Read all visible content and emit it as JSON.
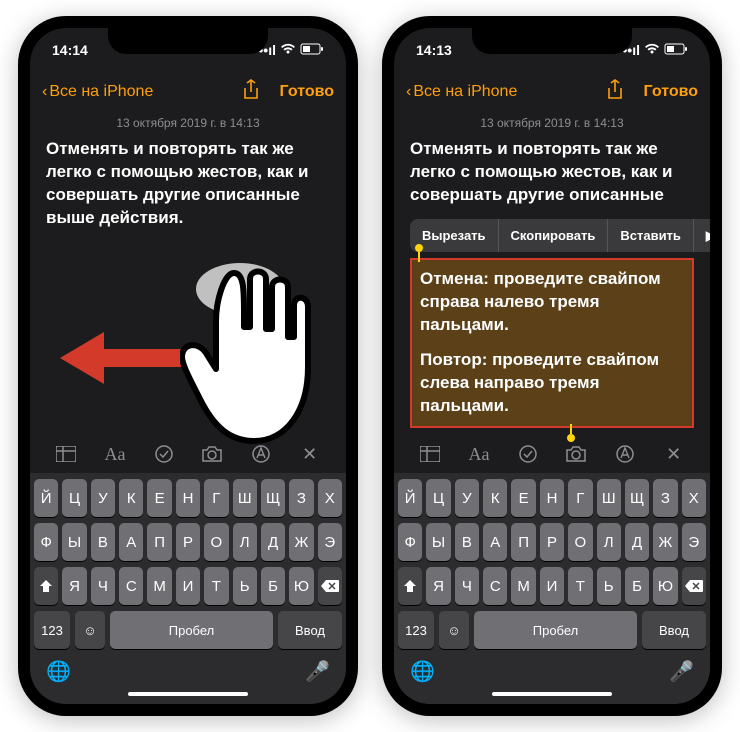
{
  "watermark": "",
  "status": {
    "time_a": "14:14",
    "time_b": "14:13"
  },
  "nav": {
    "back": "Все на iPhone",
    "done": "Готово"
  },
  "date": "13 октября 2019 г. в 14:13",
  "body": {
    "p1": "Отменять и повторять так же легко с помощью жестов, как и совершать другие описанные выше действия.",
    "p1b": "Отменять и повторять так же легко с помощью жестов, как и совершать другие описанные"
  },
  "ctx": {
    "cut": "Вырезать",
    "copy": "Скопировать",
    "paste": "Вставить",
    "more": "▶"
  },
  "hl": {
    "p2": "Отмена: проведите свайпом справа налево тремя пальцами.",
    "p3": "Повтор: проведите свайпом слева направо тремя пальцами."
  },
  "kb": {
    "r1": [
      "Й",
      "Ц",
      "У",
      "К",
      "Е",
      "Н",
      "Г",
      "Ш",
      "Щ",
      "З",
      "Х"
    ],
    "r2": [
      "Ф",
      "Ы",
      "В",
      "А",
      "П",
      "Р",
      "О",
      "Л",
      "Д",
      "Ж",
      "Э"
    ],
    "r3": [
      "Я",
      "Ч",
      "С",
      "М",
      "И",
      "Т",
      "Ь",
      "Б",
      "Ю"
    ],
    "k123": "123",
    "space": "Пробел",
    "ret": "Ввод"
  },
  "tb": {
    "aa": "Aa",
    "close": "✕"
  }
}
